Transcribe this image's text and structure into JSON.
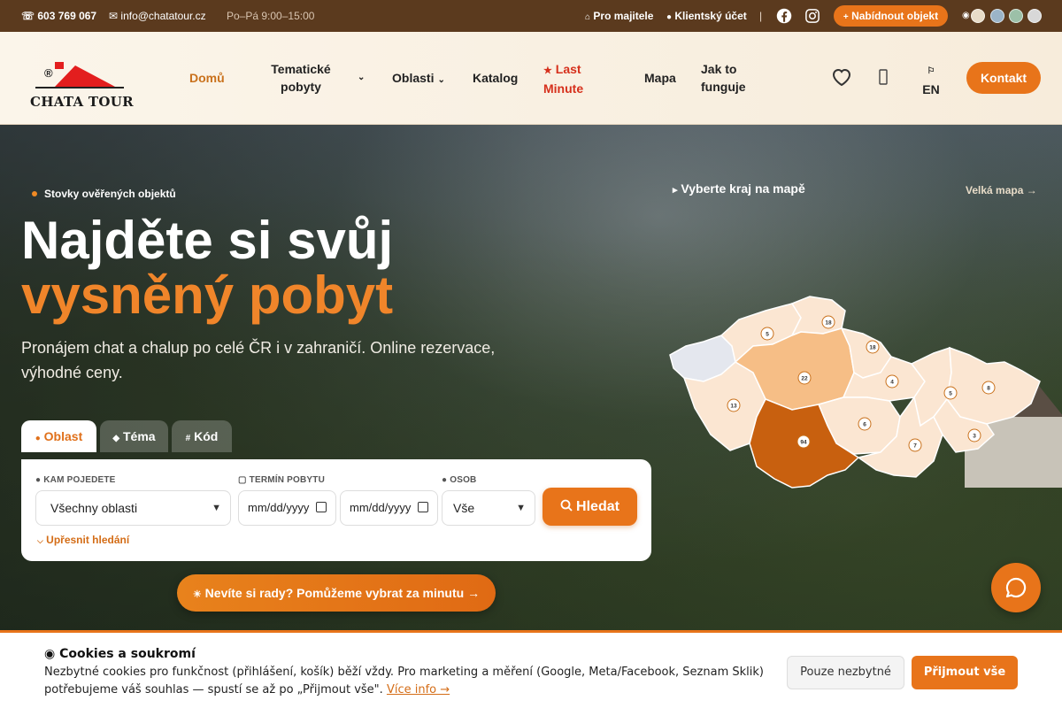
{
  "topbar": {
    "phone": "603 769 067",
    "email": "info@chatatour.cz",
    "hours": "Po–Pá 9:00–15:00",
    "owners_link": "Pro majitele",
    "account_link": "Klientský účet",
    "separator": "|",
    "offer_button": "Nabídnout objekt",
    "theme_swatches": [
      "#e8dcc8",
      "#9bb4c8",
      "#9cc0a8",
      "#d8d8d8"
    ]
  },
  "header": {
    "logo_text": "CHATA TOUR",
    "nav": {
      "home": "Domů",
      "themed": "Tematické pobyty",
      "areas": "Oblasti",
      "catalog": "Katalog",
      "last_minute": "Last Minute",
      "map": "Mapa",
      "how": "Jak to funguje"
    },
    "lang": "EN",
    "contact_button": "Kontakt"
  },
  "hero": {
    "badge": "Stovky ověřených objektů",
    "title_line1": "Najděte si svůj",
    "title_line2": "vysněný pobyt",
    "lead": "Pronájem chat a chalup po celé ČR i v zahraničí. Online rezervace, výhodné ceny.",
    "tabs": [
      "Oblast",
      "Téma",
      "Kód"
    ],
    "search": {
      "where_label": "KAM POJEDETE",
      "where_value": "Všechny oblasti",
      "date_label": "TERMÍN POBYTU",
      "date_from": "mm/dd/yyyy",
      "date_to": "mm/dd/yyyy",
      "people_label": "OSOB",
      "people_value": "Vše",
      "submit": "Hledat",
      "refine": "Upřesnit hledání"
    },
    "help_button": "Nevíte si rady? Pomůžeme vybrat za minutu →",
    "map_title": "Vyberte kraj na mapě",
    "map_link": "Velká mapa →",
    "region_counts": [
      "5",
      "18",
      "18",
      "22",
      "4",
      "5",
      "8",
      "13",
      "6",
      "94",
      "7",
      "3"
    ]
  },
  "cookie": {
    "title": "Cookies a soukromí",
    "text": "Nezbytné cookies pro funkčnost (přihlášení, košík) běží vždy. Pro marketing a měření (Google, Meta/Facebook, Seznam Sklik) potřebujeme váš souhlas — spustí se až po „Přijmout vše\".",
    "more_link": "Více info →",
    "necessary_button": "Pouze nezbytné",
    "accept_button": "Přijmout vše"
  },
  "colors": {
    "accent": "#e8741a",
    "topbar_bg": "#5b3a1e",
    "last_minute": "#d6301c"
  }
}
